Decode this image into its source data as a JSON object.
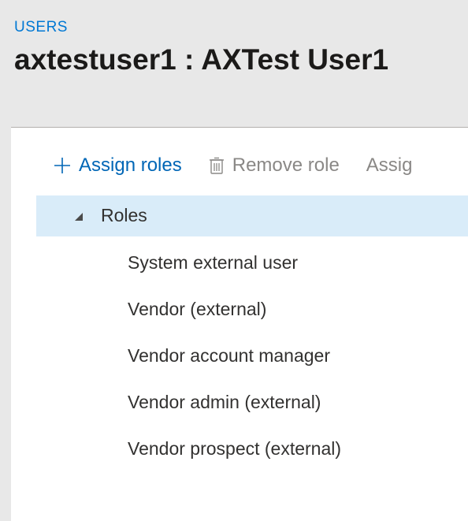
{
  "header": {
    "breadcrumb": "USERS",
    "title": "axtestuser1 : AXTest User1"
  },
  "toolbar": {
    "assign_roles": "Assign roles",
    "remove_role": "Remove role",
    "assign_orgs_truncated": "Assig"
  },
  "roles": {
    "section_label": "Roles",
    "items": [
      "System external user",
      "Vendor (external)",
      "Vendor account manager",
      "Vendor admin (external)",
      "Vendor prospect (external)"
    ]
  }
}
